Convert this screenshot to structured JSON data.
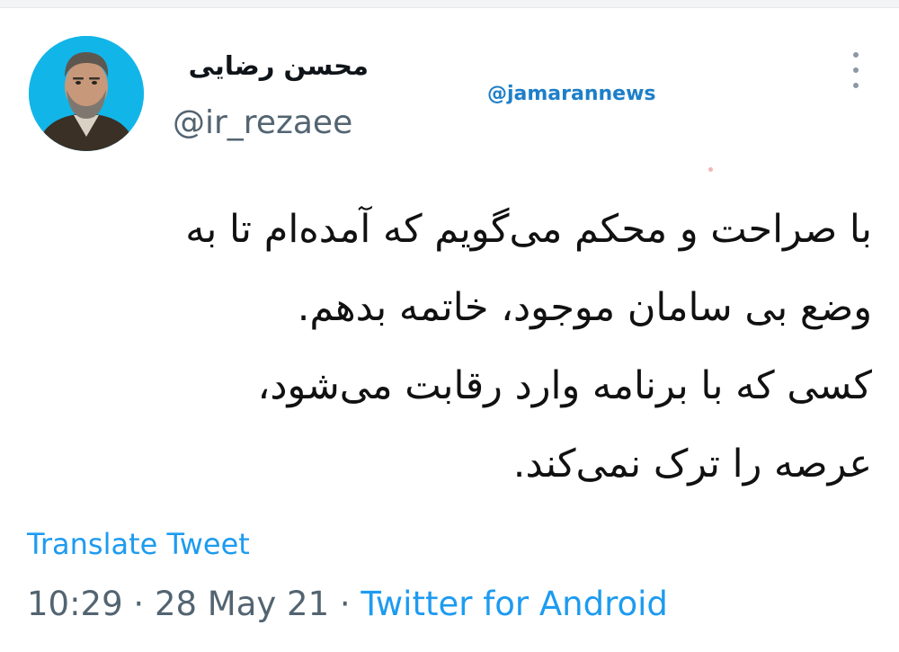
{
  "tweet": {
    "author": {
      "display_name": "محسن رضایی",
      "handle": "@ir_rezaee"
    },
    "watermark": "@jamarannews",
    "text_lines": [
      "با صراحت و محکم می‌گویم که آمده‌ام تا به",
      "وضع بی سامان موجود، خاتمه بدهم.",
      "کسی که با برنامه وارد رقابت می‌شود،",
      "عرصه را ترک نمی‌کند."
    ],
    "translate_label": "Translate Tweet",
    "time": "10:29",
    "separator": "·",
    "date": "28 May 21",
    "source": "Twitter for Android"
  },
  "colors": {
    "link": "#1d9bf0",
    "secondary_text": "#536471",
    "watermark": "#1d7fc8",
    "avatar_background": "#12b5e8"
  },
  "icons": {
    "more": "more-vertical-icon"
  }
}
